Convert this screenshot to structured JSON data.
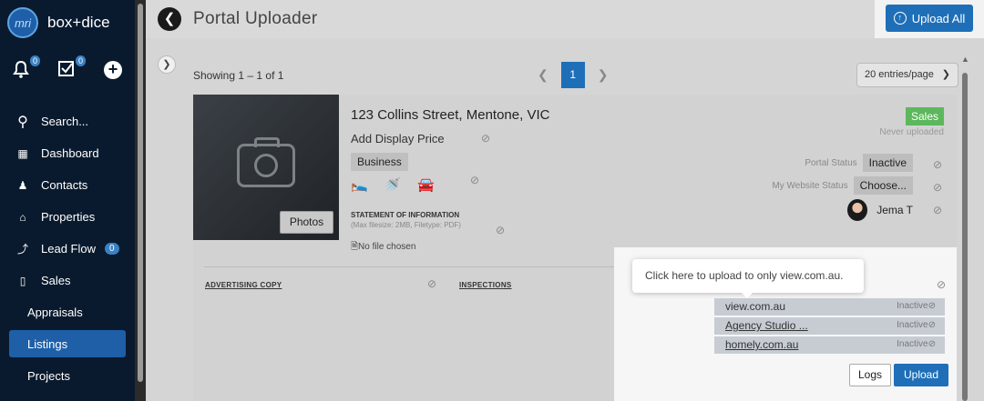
{
  "sidebar": {
    "logo_mark": "mri",
    "brand": "box+dice",
    "notifications_count": "0",
    "tasks_count": "0",
    "items": [
      {
        "label": "Search..."
      },
      {
        "label": "Dashboard"
      },
      {
        "label": "Contacts"
      },
      {
        "label": "Properties"
      },
      {
        "label": "Lead Flow",
        "badge": "0"
      },
      {
        "label": "Sales"
      },
      {
        "label": "Appraisals"
      },
      {
        "label": "Listings"
      },
      {
        "label": "Projects"
      }
    ],
    "active_item": "Listings"
  },
  "header": {
    "title": "Portal Uploader",
    "upload_all_label": "Upload All"
  },
  "list": {
    "showing": "Showing 1 – 1 of 1",
    "current_page": "1",
    "entries_per_page": "20 entries/page"
  },
  "listing": {
    "address": "123 Collins Street, Mentone, VIC",
    "price": "Add Display Price",
    "category": "Business",
    "photos_label": "Photos",
    "soi_title": "STATEMENT OF INFORMATION",
    "soi_note": "(Max filesize: 2MB, Filetype: PDF)",
    "file_status": "No file chosen",
    "type_badge": "Sales",
    "upload_state": "Never uploaded",
    "portal_status_label": "Portal Status",
    "portal_status_value": "Inactive",
    "website_status_label": "My Website Status",
    "website_status_value": "Choose...",
    "agent_name": "Jema T",
    "advertising_copy": "ADVERTISING COPY",
    "inspections": "INSPECTIONS"
  },
  "portals": [
    {
      "name": "view.com.au",
      "status": "Inactive"
    },
    {
      "name": "Agency Studio ...",
      "status": "Inactive"
    },
    {
      "name": "homely.com.au",
      "status": "Inactive"
    }
  ],
  "actions": {
    "logs_label": "Logs",
    "upload_label": "Upload"
  },
  "tooltip": "Click here to upload to only view.com.au.",
  "colors": {
    "sidebar_bg": "#0a1a2e",
    "primary": "#1e6fb8",
    "sales_badge": "#5cb85c"
  }
}
